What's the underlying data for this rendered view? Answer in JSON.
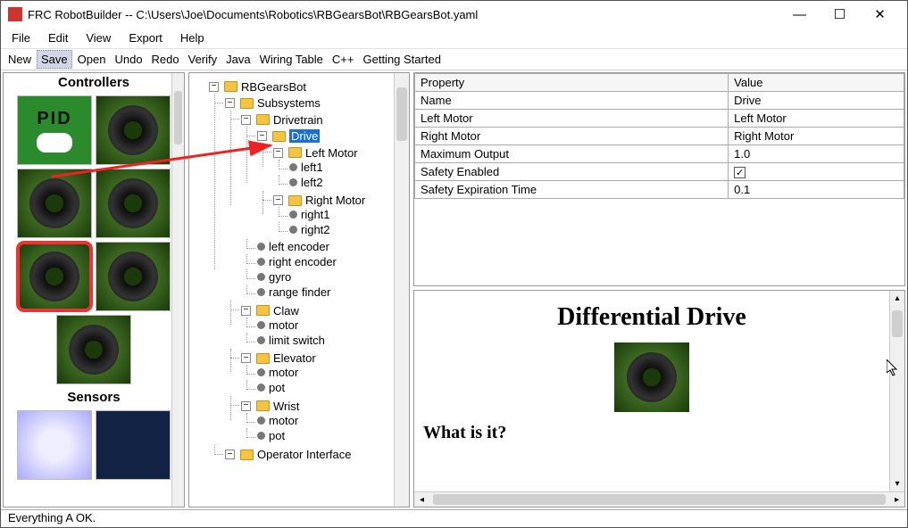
{
  "window": {
    "title": "FRC RobotBuilder -- C:\\Users\\Joe\\Documents\\Robotics\\RBGearsBot\\RBGearsBot.yaml"
  },
  "menubar": {
    "file": "File",
    "edit": "Edit",
    "view": "View",
    "export": "Export",
    "help": "Help"
  },
  "toolbar": {
    "new": "New",
    "save": "Save",
    "open": "Open",
    "undo": "Undo",
    "redo": "Redo",
    "verify": "Verify",
    "java": "Java",
    "wiring": "Wiring Table",
    "cpp": "C++",
    "getting": "Getting Started"
  },
  "palette": {
    "controllers": "Controllers",
    "sensors": "Sensors",
    "pid": "PID"
  },
  "tree": {
    "root": "RBGearsBot",
    "subsystems": "Subsystems",
    "drivetrain": "Drivetrain",
    "drive": "Drive",
    "leftmotor": "Left Motor",
    "left1": "left1",
    "left2": "left2",
    "rightmotor": "Right Motor",
    "right1": "right1",
    "right2": "right2",
    "leftencoder": "left encoder",
    "rightencoder": "right encoder",
    "gyro": "gyro",
    "rangefinder": "range finder",
    "claw": "Claw",
    "motor": "motor",
    "limitswitch": "limit switch",
    "elevator": "Elevator",
    "pot": "pot",
    "wrist": "Wrist",
    "oi": "Operator Interface"
  },
  "props": {
    "hdr_prop": "Property",
    "hdr_val": "Value",
    "name_k": "Name",
    "name_v": "Drive",
    "lm_k": "Left Motor",
    "lm_v": "Left Motor",
    "rm_k": "Right Motor",
    "rm_v": "Right Motor",
    "max_k": "Maximum Output",
    "max_v": "1.0",
    "safe_k": "Safety Enabled",
    "exp_k": "Safety Expiration Time",
    "exp_v": "0.1"
  },
  "info": {
    "title": "Differential Drive",
    "h2": "What is it?"
  },
  "status": {
    "text": "Everything A OK."
  }
}
